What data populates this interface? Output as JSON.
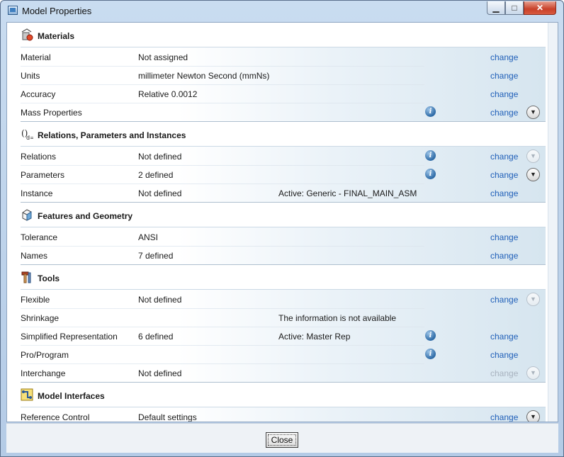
{
  "window": {
    "title": "Model Properties"
  },
  "window_controls": {
    "minimize": "▁",
    "maximize": "□",
    "close": "✕"
  },
  "sections": [
    {
      "title": "Materials",
      "icon": "materials-icon",
      "rows": [
        {
          "label": "Material",
          "value": "Not assigned",
          "extra": "",
          "info": false,
          "change": "change",
          "change_enabled": true,
          "expand": "none"
        },
        {
          "label": "Units",
          "value": "millimeter Newton Second (mmNs)",
          "extra": "",
          "info": false,
          "change": "change",
          "change_enabled": true,
          "expand": "none"
        },
        {
          "label": "Accuracy",
          "value": "Relative 0.0012",
          "extra": "",
          "info": false,
          "change": "change",
          "change_enabled": true,
          "expand": "none"
        },
        {
          "label": "Mass Properties",
          "value": "",
          "extra": "",
          "info": true,
          "change": "change",
          "change_enabled": true,
          "expand": "active"
        }
      ]
    },
    {
      "title": "Relations, Parameters and Instances",
      "icon": "relations-icon",
      "rows": [
        {
          "label": "Relations",
          "value": "Not defined",
          "extra": "",
          "info": true,
          "change": "change",
          "change_enabled": true,
          "expand": "dim"
        },
        {
          "label": "Parameters",
          "value": "2 defined",
          "extra": "",
          "info": true,
          "change": "change",
          "change_enabled": true,
          "expand": "active"
        },
        {
          "label": "Instance",
          "value": "Not defined",
          "extra": "Active: Generic - FINAL_MAIN_ASM",
          "info": false,
          "change": "change",
          "change_enabled": true,
          "expand": "none"
        }
      ]
    },
    {
      "title": "Features and Geometry",
      "icon": "features-geometry-icon",
      "rows": [
        {
          "label": "Tolerance",
          "value": "ANSI",
          "extra": "",
          "info": false,
          "change": "change",
          "change_enabled": true,
          "expand": "none"
        },
        {
          "label": "Names",
          "value": "7 defined",
          "extra": "",
          "info": false,
          "change": "change",
          "change_enabled": true,
          "expand": "none"
        }
      ]
    },
    {
      "title": "Tools",
      "icon": "tools-icon",
      "rows": [
        {
          "label": "Flexible",
          "value": "Not defined",
          "extra": "",
          "info": false,
          "change": "change",
          "change_enabled": true,
          "expand": "dim"
        },
        {
          "label": "Shrinkage",
          "value": "",
          "extra": "The information is not available",
          "info": false,
          "change": "",
          "change_enabled": false,
          "expand": "none"
        },
        {
          "label": "Simplified Representation",
          "value": "6 defined",
          "extra": "Active: Master Rep",
          "info": true,
          "change": "change",
          "change_enabled": true,
          "expand": "none"
        },
        {
          "label": "Pro/Program",
          "value": "",
          "extra": "",
          "info": true,
          "change": "change",
          "change_enabled": true,
          "expand": "none"
        },
        {
          "label": "Interchange",
          "value": "Not defined",
          "extra": "",
          "info": false,
          "change": "change",
          "change_enabled": false,
          "expand": "dim"
        }
      ]
    },
    {
      "title": "Model Interfaces",
      "icon": "model-interfaces-icon",
      "rows": [
        {
          "label": "Reference Control",
          "value": "Default settings",
          "extra": "",
          "info": false,
          "change": "change",
          "change_enabled": true,
          "expand": "active"
        }
      ]
    }
  ],
  "footer": {
    "close_label": "Close"
  }
}
